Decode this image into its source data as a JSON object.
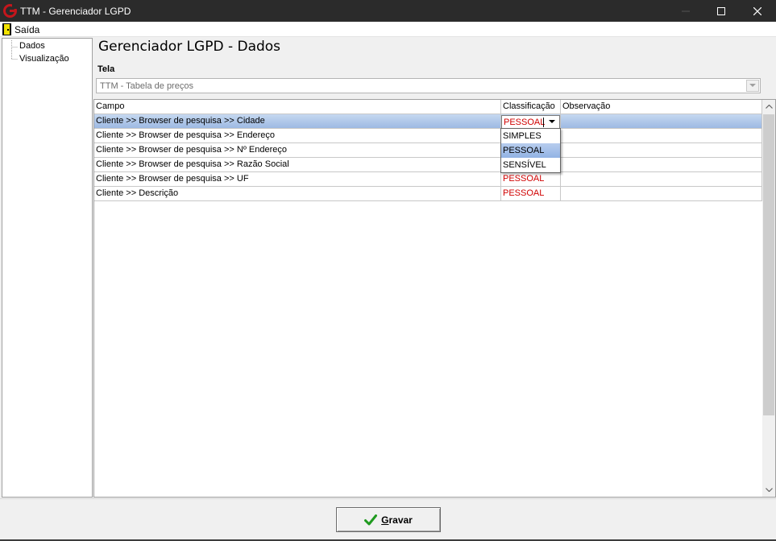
{
  "window": {
    "title": "TTM - Gerenciador LGPD",
    "controls": [
      "minimize-icon",
      "maximize-icon",
      "close-icon"
    ],
    "brand_color": "#c4161c"
  },
  "menu": {
    "exit_label": "Saída",
    "exit_icon": "door-exit-icon"
  },
  "sidebar": {
    "items": [
      {
        "label": "Dados"
      },
      {
        "label": "Visualização"
      }
    ]
  },
  "main": {
    "heading": "Gerenciador LGPD - Dados",
    "screen_label": "Tela",
    "screen_value": "TTM - Tabela de preços"
  },
  "grid": {
    "columns": [
      "Campo",
      "Classificação",
      "Observação"
    ],
    "rows": [
      {
        "campo": "Cliente >> Browser de pesquisa >> Cidade",
        "classificacao": "PESSOAL",
        "observacao": "",
        "selected": true
      },
      {
        "campo": "Cliente >> Browser de pesquisa >> Endereço",
        "classificacao": "",
        "observacao": ""
      },
      {
        "campo": "Cliente >> Browser de pesquisa >> Nº Endereço",
        "classificacao": "",
        "observacao": ""
      },
      {
        "campo": "Cliente >> Browser de pesquisa >> Razão Social",
        "classificacao": "",
        "observacao": ""
      },
      {
        "campo": "Cliente >> Browser de pesquisa >> UF",
        "classificacao": "PESSOAL",
        "observacao": ""
      },
      {
        "campo": "Cliente >> Descrição",
        "classificacao": "PESSOAL",
        "observacao": ""
      }
    ],
    "editor_value": "PESSOAL",
    "dropdown_options": [
      "SIMPLES",
      "PESSOAL",
      "SENSÍVEL"
    ],
    "dropdown_highlighted": "PESSOAL",
    "classification_color": "#d00000",
    "selection_color": "#9db9e3"
  },
  "footer": {
    "save_label": "Gravar",
    "save_icon": "green-check-icon"
  }
}
